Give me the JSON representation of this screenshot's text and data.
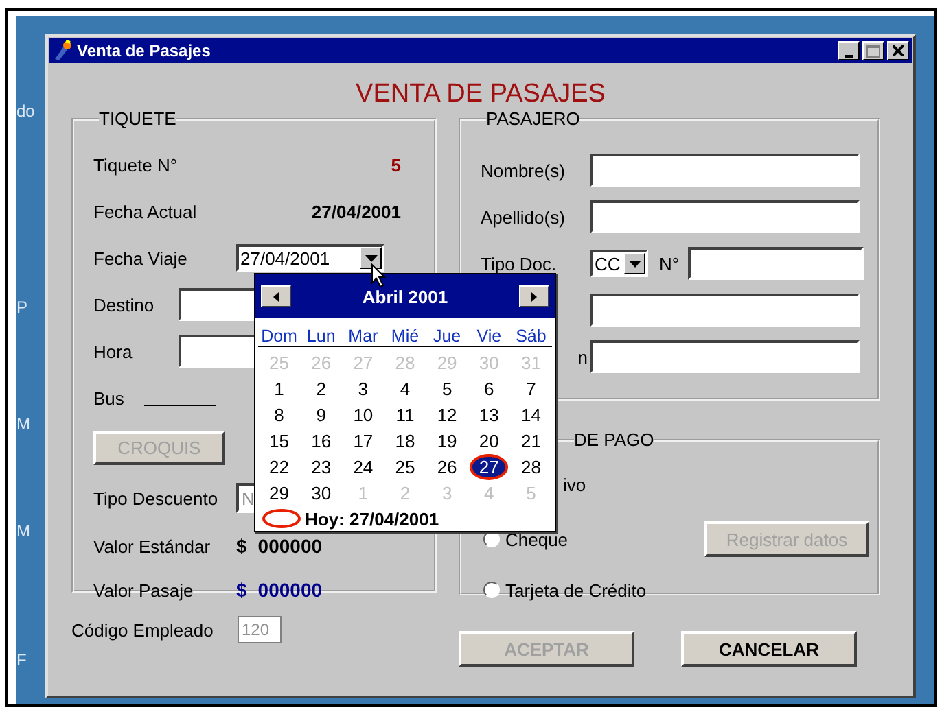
{
  "desktop": {
    "labels": [
      "do",
      "P",
      "M",
      "M",
      "F"
    ]
  },
  "window": {
    "title": "Venta de Pasajes",
    "controls": [
      {
        "kind": "minimize",
        "disabled": false
      },
      {
        "kind": "maximize",
        "disabled": true
      },
      {
        "kind": "close",
        "disabled": false
      }
    ]
  },
  "heading": "VENTA DE PASAJES",
  "tiquete": {
    "legend": "TIQUETE",
    "rows": [
      {
        "kind": "value",
        "label": "Tiquete N°",
        "value": "5",
        "color": "#990000"
      },
      {
        "kind": "value",
        "label": "Fecha Actual",
        "value": "27/04/2001",
        "color": "#000000"
      },
      {
        "kind": "combo",
        "label": "Fecha Viaje",
        "value": "27/04/2001"
      },
      {
        "kind": "field",
        "label": "Destino"
      },
      {
        "kind": "field",
        "label": "Hora"
      },
      {
        "kind": "blank",
        "label": "Bus"
      },
      {
        "kind": "button",
        "label": "CROQUIS",
        "disabled": true
      },
      {
        "kind": "field",
        "label": "Tipo Descuento",
        "value": "N",
        "disabled": true
      },
      {
        "kind": "money",
        "label": "Valor Estándar",
        "currency": "$",
        "value": "000000",
        "color": "#000000"
      },
      {
        "kind": "money",
        "label": "Valor Pasaje",
        "currency": "$",
        "value": "000000",
        "color": "#00008b"
      }
    ]
  },
  "employee": {
    "label": "Código Empleado",
    "value": "120",
    "disabled": true
  },
  "pasajero": {
    "legend": "PASAJERO",
    "rows": [
      {
        "kind": "field",
        "label": "Nombre(s)"
      },
      {
        "kind": "field",
        "label": "Apellido(s)"
      },
      {
        "kind": "doc",
        "label": "Tipo Doc.",
        "value": "CC",
        "number_label": "N°"
      },
      {
        "kind": "field"
      },
      {
        "kind": "field",
        "label": "n",
        "partial": true
      }
    ]
  },
  "pago": {
    "legend": "DE PAGO",
    "options": [
      {
        "label": "ivo",
        "partial": true
      },
      {
        "label": "Cheque",
        "selected": false
      },
      {
        "label": "Tarjeta de Crédito",
        "selected": false
      }
    ],
    "register_button": {
      "label": "Registrar datos",
      "disabled": true
    }
  },
  "buttons": [
    {
      "label": "ACEPTAR",
      "disabled": true
    },
    {
      "label": "CANCELAR",
      "disabled": false
    }
  ],
  "calendar": {
    "month": "Abril 2001",
    "weekdays": [
      "Dom",
      "Lun",
      "Mar",
      "Mié",
      "Jue",
      "Vie",
      "Sáb"
    ],
    "weeks": [
      [
        {
          "day": "25",
          "in_month": false,
          "selected": false
        },
        {
          "day": "26",
          "in_month": false,
          "selected": false
        },
        {
          "day": "27",
          "in_month": false,
          "selected": false
        },
        {
          "day": "28",
          "in_month": false,
          "selected": false
        },
        {
          "day": "29",
          "in_month": false,
          "selected": false
        },
        {
          "day": "30",
          "in_month": false,
          "selected": false
        },
        {
          "day": "31",
          "in_month": false,
          "selected": false
        }
      ],
      [
        {
          "day": "1",
          "in_month": true,
          "selected": false
        },
        {
          "day": "2",
          "in_month": true,
          "selected": false
        },
        {
          "day": "3",
          "in_month": true,
          "selected": false
        },
        {
          "day": "4",
          "in_month": true,
          "selected": false
        },
        {
          "day": "5",
          "in_month": true,
          "selected": false
        },
        {
          "day": "6",
          "in_month": true,
          "selected": false
        },
        {
          "day": "7",
          "in_month": true,
          "selected": false
        }
      ],
      [
        {
          "day": "8",
          "in_month": true,
          "selected": false
        },
        {
          "day": "9",
          "in_month": true,
          "selected": false
        },
        {
          "day": "10",
          "in_month": true,
          "selected": false
        },
        {
          "day": "11",
          "in_month": true,
          "selected": false
        },
        {
          "day": "12",
          "in_month": true,
          "selected": false
        },
        {
          "day": "13",
          "in_month": true,
          "selected": false
        },
        {
          "day": "14",
          "in_month": true,
          "selected": false
        }
      ],
      [
        {
          "day": "15",
          "in_month": true,
          "selected": false
        },
        {
          "day": "16",
          "in_month": true,
          "selected": false
        },
        {
          "day": "17",
          "in_month": true,
          "selected": false
        },
        {
          "day": "18",
          "in_month": true,
          "selected": false
        },
        {
          "day": "19",
          "in_month": true,
          "selected": false
        },
        {
          "day": "20",
          "in_month": true,
          "selected": false
        },
        {
          "day": "21",
          "in_month": true,
          "selected": false
        }
      ],
      [
        {
          "day": "22",
          "in_month": true,
          "selected": false
        },
        {
          "day": "23",
          "in_month": true,
          "selected": false
        },
        {
          "day": "24",
          "in_month": true,
          "selected": false
        },
        {
          "day": "25",
          "in_month": true,
          "selected": false
        },
        {
          "day": "26",
          "in_month": true,
          "selected": false
        },
        {
          "day": "27",
          "in_month": true,
          "selected": true
        },
        {
          "day": "28",
          "in_month": true,
          "selected": false
        }
      ],
      [
        {
          "day": "29",
          "in_month": true,
          "selected": false
        },
        {
          "day": "30",
          "in_month": true,
          "selected": false
        },
        {
          "day": "1",
          "in_month": false,
          "selected": false
        },
        {
          "day": "2",
          "in_month": false,
          "selected": false
        },
        {
          "day": "3",
          "in_month": false,
          "selected": false
        },
        {
          "day": "4",
          "in_month": false,
          "selected": false
        },
        {
          "day": "5",
          "in_month": false,
          "selected": false
        }
      ]
    ],
    "today": "Hoy: 27/04/2001"
  }
}
